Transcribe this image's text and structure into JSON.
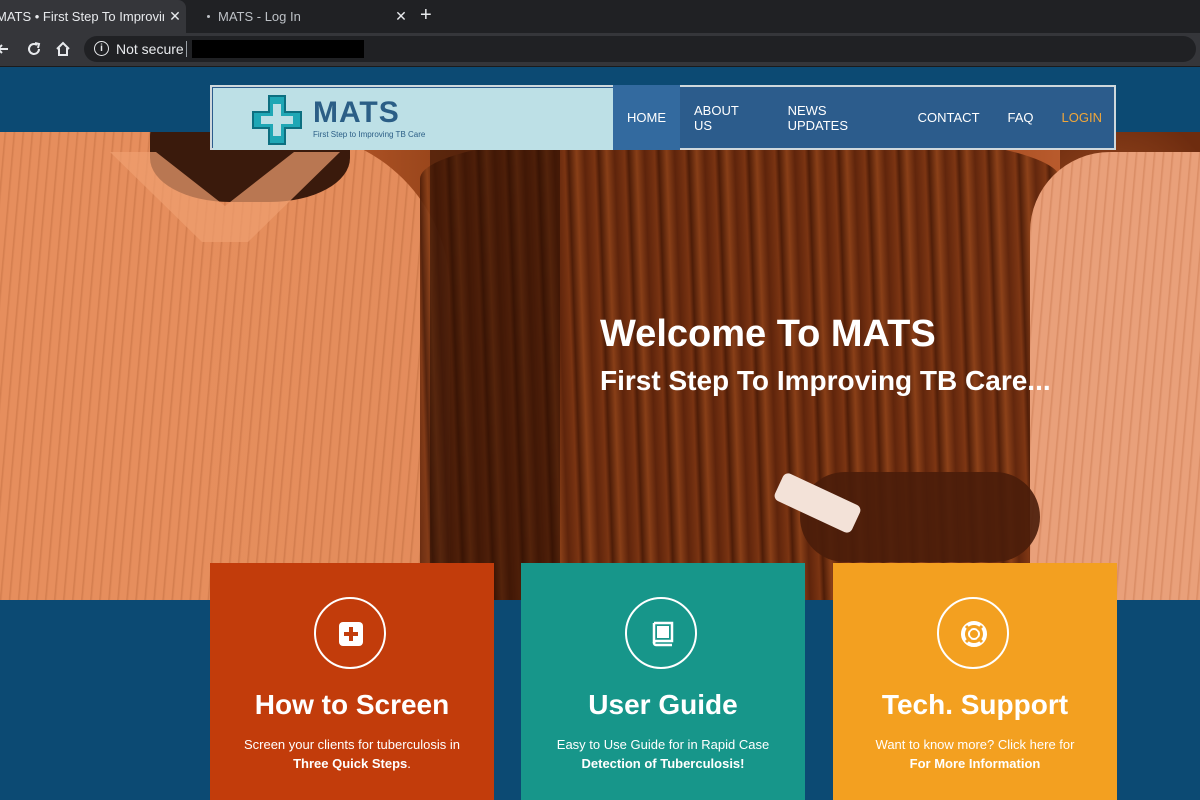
{
  "browser": {
    "tabs": [
      {
        "title": "MATS • First Step To Improving T",
        "close": "✕"
      },
      {
        "title": "MATS - Log In",
        "close": "✕"
      }
    ],
    "new_tab": "+",
    "security_label": "Not secure",
    "info_glyph": "i"
  },
  "header": {
    "logo_word": "MATS",
    "logo_tagline": "First Step to Improving TB Care",
    "nav": [
      "HOME",
      "ABOUT US",
      "NEWS UPDATES",
      "CONTACT",
      "FAQ",
      "LOGIN"
    ],
    "colors": {
      "header_bg": "#2c5c8c",
      "login": "#f0a63a"
    }
  },
  "hero": {
    "title": "Welcome To MATS",
    "subtitle": "First Step To Improving TB Care..."
  },
  "cards": [
    {
      "title": "How to Screen",
      "line1": "Screen your clients for tuberculosis in",
      "line2": "Three Quick Steps",
      "line2_suffix": ".",
      "icon": "plus-square-icon",
      "color": "#c23c0b"
    },
    {
      "title": "User Guide",
      "line1": "Easy to Use Guide for in Rapid Case",
      "line2": "Detection of Tuberculosis!",
      "line2_suffix": "",
      "icon": "book-icon",
      "color": "#17968a"
    },
    {
      "title": "Tech. Support",
      "line1": "Want to know more? Click here for",
      "line2": "For More Information",
      "line2_suffix": "",
      "icon": "life-ring-icon",
      "color": "#f3a020"
    }
  ]
}
